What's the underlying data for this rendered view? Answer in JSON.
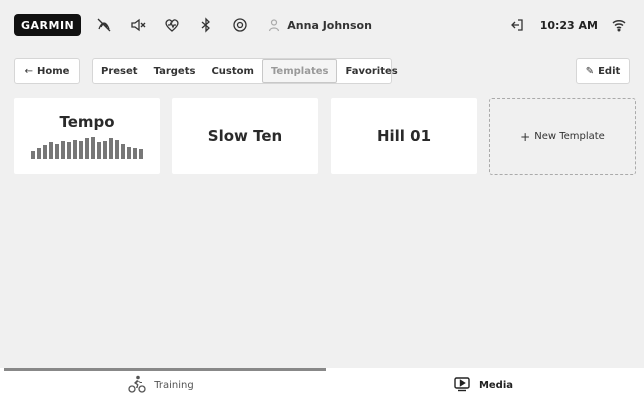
{
  "status_bar": {
    "logo": "GARMIN",
    "icons": [
      "no-signal-icon",
      "volume-mute-icon",
      "heart-rate-icon",
      "bluetooth-icon",
      "target-icon"
    ],
    "user_name": "Anna Johnson",
    "time": "10:23 AM",
    "right_icons": [
      "logout-icon",
      "wifi-icon"
    ]
  },
  "nav": {
    "home_label": "Home",
    "tabs": [
      {
        "label": "Preset",
        "active": false
      },
      {
        "label": "Targets",
        "active": false
      },
      {
        "label": "Custom",
        "active": false
      },
      {
        "label": "Templates",
        "active": true
      },
      {
        "label": "Favorites",
        "active": false
      }
    ],
    "edit_label": "Edit"
  },
  "cards": [
    {
      "title": "Tempo",
      "has_profile": true,
      "profile": [
        6,
        8,
        10,
        12,
        11,
        13,
        12,
        14,
        13,
        15,
        16,
        12,
        13,
        15,
        14,
        11,
        9,
        8,
        7
      ]
    },
    {
      "title": "Slow Ten",
      "has_profile": false
    },
    {
      "title": "Hill 01",
      "has_profile": false
    }
  ],
  "new_template_label": "New Template",
  "bottom_tabs": [
    {
      "label": "Training",
      "icon": "cycling-icon",
      "active": true
    },
    {
      "label": "Media",
      "icon": "media-play-icon",
      "active": false
    }
  ],
  "colors": {
    "background": "#f0f0f0",
    "card": "#ffffff",
    "logo_bg": "#111111",
    "profile_bars": "#777777"
  }
}
